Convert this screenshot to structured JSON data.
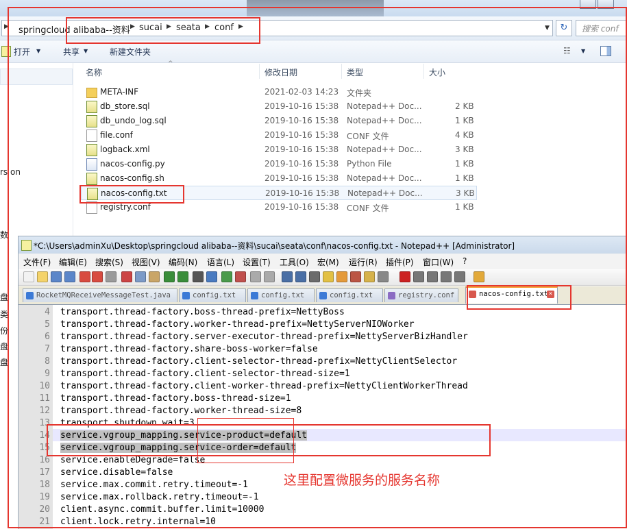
{
  "explorer": {
    "breadcrumb": [
      "springcloud alibaba--资料",
      "sucai",
      "seata",
      "conf"
    ],
    "search_placeholder": "搜索 conf",
    "toolbar": {
      "open": "打开",
      "share": "共享",
      "new_folder": "新建文件夹"
    },
    "sidebar_fragments": [
      "rs on",
      "数",
      "盘",
      "类",
      "份",
      "盘",
      "盘"
    ],
    "columns": {
      "name": "名称",
      "modified": "修改日期",
      "type": "类型",
      "size": "大小"
    },
    "files": [
      {
        "name": "META-INF",
        "modified": "2021-02-03 14:23",
        "type": "文件夹",
        "size": "",
        "icon": "folder-icon"
      },
      {
        "name": "db_store.sql",
        "modified": "2019-10-16 15:38",
        "type": "Notepad++ Doc...",
        "size": "2 KB",
        "icon": "notepad-doc-icon"
      },
      {
        "name": "db_undo_log.sql",
        "modified": "2019-10-16 15:38",
        "type": "Notepad++ Doc...",
        "size": "1 KB",
        "icon": "notepad-doc-icon"
      },
      {
        "name": "file.conf",
        "modified": "2019-10-16 15:38",
        "type": "CONF 文件",
        "size": "4 KB",
        "icon": "file-icon"
      },
      {
        "name": "logback.xml",
        "modified": "2019-10-16 15:38",
        "type": "Notepad++ Doc...",
        "size": "3 KB",
        "icon": "notepad-doc-icon"
      },
      {
        "name": "nacos-config.py",
        "modified": "2019-10-16 15:38",
        "type": "Python File",
        "size": "1 KB",
        "icon": "python-file-icon"
      },
      {
        "name": "nacos-config.sh",
        "modified": "2019-10-16 15:38",
        "type": "Notepad++ Doc...",
        "size": "1 KB",
        "icon": "notepad-doc-icon"
      },
      {
        "name": "nacos-config.txt",
        "modified": "2019-10-16 15:38",
        "type": "Notepad++ Doc...",
        "size": "3 KB",
        "icon": "notepad-doc-icon"
      },
      {
        "name": "registry.conf",
        "modified": "2019-10-16 15:38",
        "type": "CONF 文件",
        "size": "1 KB",
        "icon": "file-icon"
      }
    ]
  },
  "notepad": {
    "title": "*C:\\Users\\adminXu\\Desktop\\springcloud alibaba--资料\\sucai\\seata\\conf\\nacos-config.txt - Notepad++ [Administrator]",
    "menu": [
      "文件(F)",
      "编辑(E)",
      "搜索(S)",
      "视图(V)",
      "编码(N)",
      "语言(L)",
      "设置(T)",
      "工具(O)",
      "宏(M)",
      "运行(R)",
      "插件(P)",
      "窗口(W)",
      "?"
    ],
    "tabs": [
      "RocketMQReceiveMessageTest.java",
      "config.txt",
      "config.txt",
      "config.txt",
      "registry.conf",
      "nacos-config.txt"
    ],
    "lines": [
      {
        "n": "4",
        "text": "transport.thread-factory.boss-thread-prefix=NettyBoss"
      },
      {
        "n": "5",
        "text": "transport.thread-factory.worker-thread-prefix=NettyServerNIOWorker"
      },
      {
        "n": "6",
        "text": "transport.thread-factory.server-executor-thread-prefix=NettyServerBizHandler"
      },
      {
        "n": "7",
        "text": "transport.thread-factory.share-boss-worker=false"
      },
      {
        "n": "8",
        "text": "transport.thread-factory.client-selector-thread-prefix=NettyClientSelector"
      },
      {
        "n": "9",
        "text": "transport.thread-factory.client-selector-thread-size=1"
      },
      {
        "n": "10",
        "text": "transport.thread-factory.client-worker-thread-prefix=NettyClientWorkerThread"
      },
      {
        "n": "11",
        "text": "transport.thread-factory.boss-thread-size=1"
      },
      {
        "n": "12",
        "text": "transport.thread-factory.worker-thread-size=8"
      },
      {
        "n": "13",
        "text": "transport.shutdown.wait=3"
      },
      {
        "n": "14",
        "text": "service.vgroup_mapping.service-product=default"
      },
      {
        "n": "15",
        "text": "service.vgroup_mapping.service-order=default"
      },
      {
        "n": "16",
        "text": "service.enableDegrade=false"
      },
      {
        "n": "17",
        "text": "service.disable=false"
      },
      {
        "n": "18",
        "text": "service.max.commit.retry.timeout=-1"
      },
      {
        "n": "19",
        "text": "service.max.rollback.retry.timeout=-1"
      },
      {
        "n": "20",
        "text": "client.async.commit.buffer.limit=10000"
      },
      {
        "n": "21",
        "text": "client.lock.retry.internal=10"
      }
    ]
  },
  "annotation": "这里配置微服务的服务名称",
  "colors": {
    "annotation_red": "#e5362f",
    "tab_active_accent": "#f3a33a",
    "selection_gray": "#c0c0c0"
  }
}
